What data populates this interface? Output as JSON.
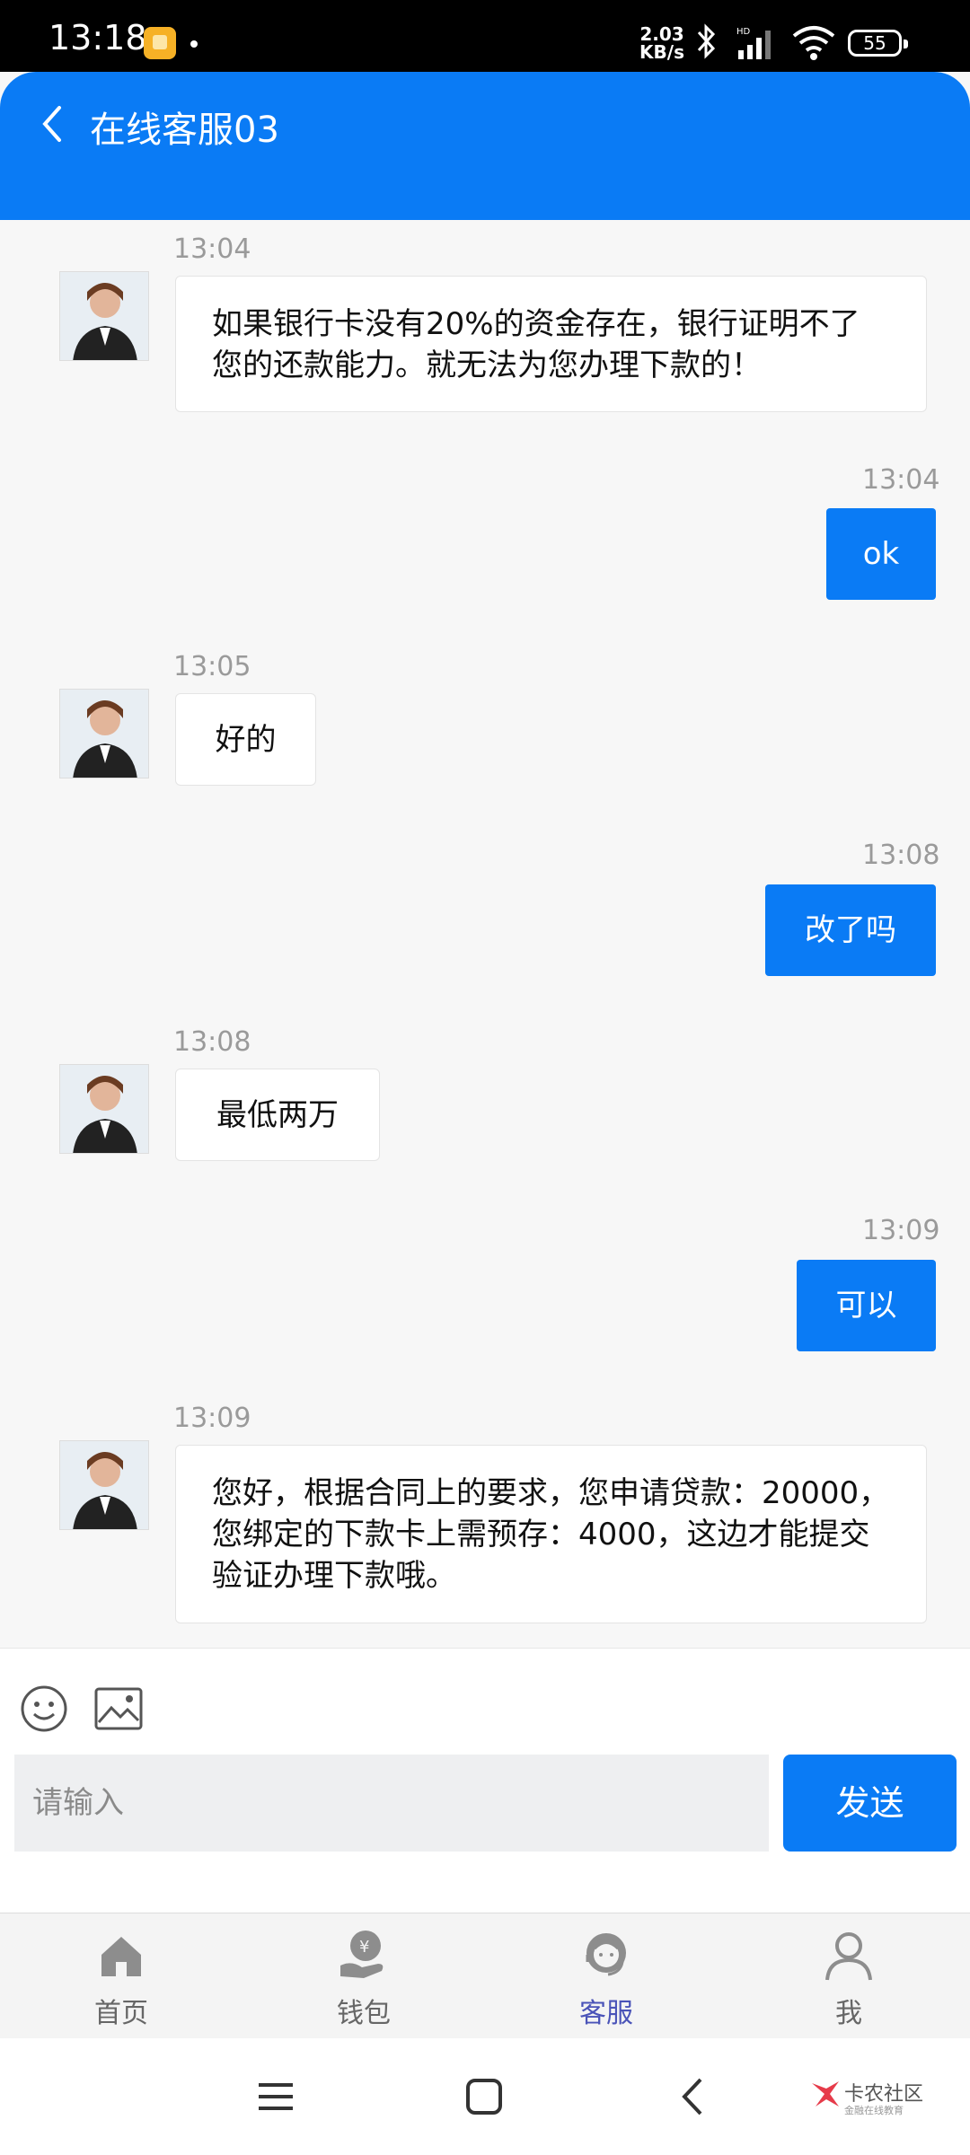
{
  "status_bar": {
    "time": "13:18",
    "network_speed": "2.03 KB/s",
    "battery": "55"
  },
  "header": {
    "title": "在线客服03",
    "back_icon": "chevron-left-icon"
  },
  "messages": [
    {
      "direction": "in",
      "time": "13:04",
      "text": "如果银行卡没有20%的资金存在，银行证明不了您的还款能力。就无法为您办理下款的！"
    },
    {
      "direction": "out",
      "time": "13:04",
      "text": "ok"
    },
    {
      "direction": "in",
      "time": "13:05",
      "text": "好的"
    },
    {
      "direction": "out",
      "time": "13:08",
      "text": "改了吗"
    },
    {
      "direction": "in",
      "time": "13:08",
      "text": "最低两万"
    },
    {
      "direction": "out",
      "time": "13:09",
      "text": "可以"
    },
    {
      "direction": "in",
      "time": "13:09",
      "text": "您好，根据合同上的要求，您申请贷款：20000，您绑定的下款卡上需预存：4000，这边才能提交验证办理下款哦。"
    }
  ],
  "input": {
    "placeholder": "请输入",
    "send_label": "发送"
  },
  "bottom_nav": {
    "items": [
      {
        "label": "首页",
        "icon": "home-icon",
        "active": false
      },
      {
        "label": "钱包",
        "icon": "wallet-icon",
        "active": false
      },
      {
        "label": "客服",
        "icon": "customer-service-icon",
        "active": true
      },
      {
        "label": "我",
        "icon": "profile-icon",
        "active": false
      }
    ]
  },
  "watermark": {
    "title": "卡农社区",
    "subtitle": "金融在线教育"
  },
  "colors": {
    "accent": "#0a7bf5",
    "active_nav": "#4a53b8"
  }
}
